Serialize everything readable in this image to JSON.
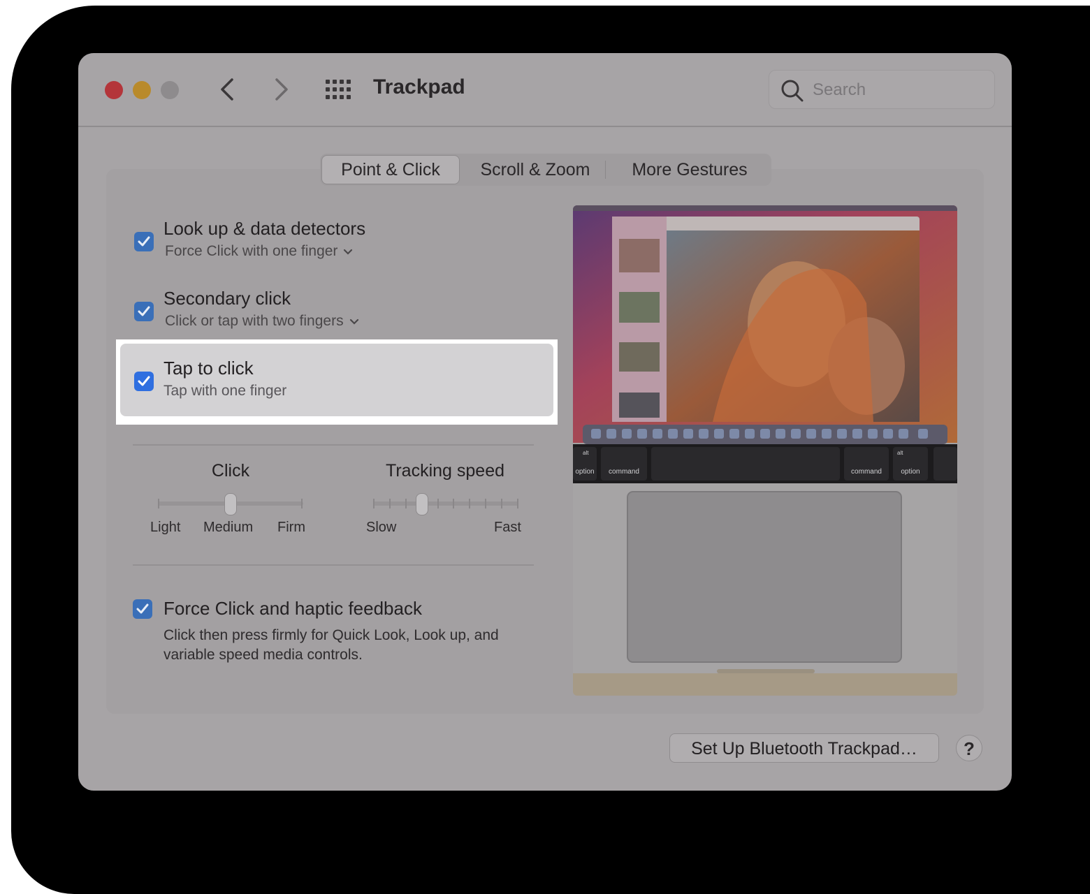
{
  "window": {
    "title": "Trackpad",
    "search_placeholder": "Search"
  },
  "tabs": [
    {
      "label": "Point & Click",
      "active": true
    },
    {
      "label": "Scroll & Zoom",
      "active": false
    },
    {
      "label": "More Gestures",
      "active": false
    }
  ],
  "options": {
    "lookup": {
      "title": "Look up & data detectors",
      "subtitle": "Force Click with one finger",
      "checked": true
    },
    "secondary": {
      "title": "Secondary click",
      "subtitle": "Click or tap with two fingers",
      "checked": true
    },
    "tap": {
      "title": "Tap to click",
      "subtitle": "Tap with one finger",
      "checked": true
    },
    "force": {
      "title": "Force Click and haptic feedback",
      "description": "Click then press firmly for Quick Look, Look up, and variable speed media controls.",
      "checked": true
    }
  },
  "click_slider": {
    "title": "Click",
    "labels": [
      "Light",
      "Medium",
      "Firm"
    ],
    "value": "Medium"
  },
  "tracking_slider": {
    "title": "Tracking speed",
    "min_label": "Slow",
    "max_label": "Fast",
    "position_fraction": 0.33
  },
  "preview_keys": [
    "option",
    "command",
    "command",
    "option",
    "alt",
    "alt"
  ],
  "buttons": {
    "setup": "Set Up Bluetooth Trackpad…",
    "help": "?"
  },
  "colors": {
    "checkbox": "#3a6fb8",
    "close": "#b4353a",
    "minimize": "#b98a2b"
  }
}
